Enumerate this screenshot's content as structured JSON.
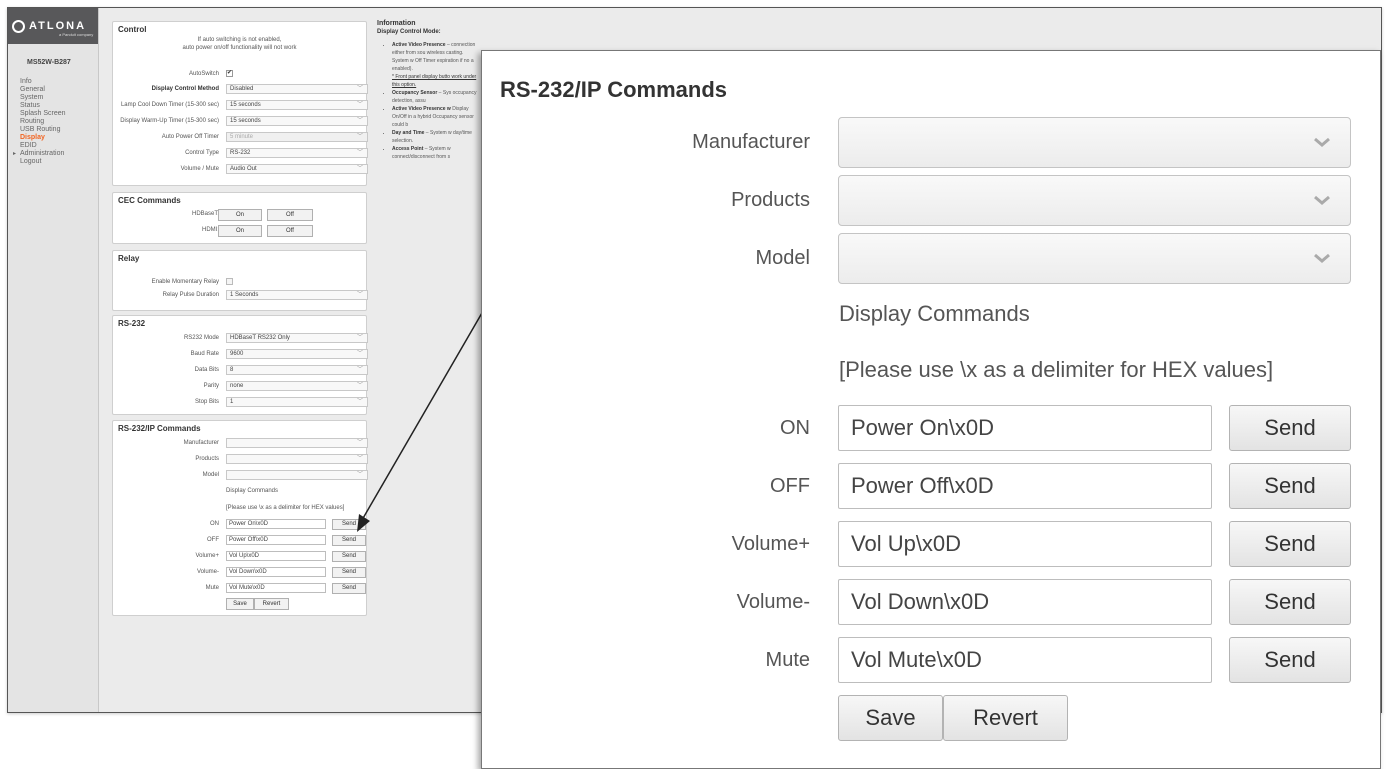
{
  "sidebar": {
    "logo_text": "ATLONA",
    "logo_sub": "a Panduit company",
    "device_name": "MS52W-B287",
    "nav": [
      "Info",
      "General",
      "System",
      "Status",
      "Splash Screen",
      "Routing",
      "USB Routing",
      "Display",
      "EDID",
      "Administration",
      "Logout"
    ],
    "active": "Display"
  },
  "control": {
    "title": "Control",
    "note_line1": "If auto switching is not enabled,",
    "note_line2": "auto power on/off functionality will not work",
    "autoswitch_label": "AutoSwitch",
    "autoswitch_checked": true,
    "method_label": "Display Control Method",
    "method_value": "Disabled",
    "cooldown_label": "Lamp Cool Down Timer (15-300 sec)",
    "cooldown_value": "15 seconds",
    "warmup_label": "Display Warm-Up Timer (15-300 sec)",
    "warmup_value": "15 seconds",
    "autooff_label": "Auto Power Off Timer",
    "autooff_value": "5 minute",
    "type_label": "Control Type",
    "type_value": "RS-232",
    "volume_label": "Volume / Mute",
    "volume_value": "Audio Out"
  },
  "cec": {
    "title": "CEC Commands",
    "hdbaset_label": "HDBaseT:",
    "hdmi_label": "HDMI:",
    "on_label": "On",
    "off_label": "Off"
  },
  "relay": {
    "title": "Relay",
    "momentary_label": "Enable Momentary Relay",
    "momentary_checked": false,
    "pulse_label": "Relay Pulse Duration",
    "pulse_value": "1 Seconds"
  },
  "rs232": {
    "title": "RS-232",
    "mode_label": "RS232 Mode",
    "mode_value": "HDBaseT RS232 Only",
    "baud_label": "Baud Rate",
    "baud_value": "9600",
    "databits_label": "Data Bits",
    "databits_value": "8",
    "parity_label": "Parity",
    "parity_value": "none",
    "stopbits_label": "Stop Bits",
    "stopbits_value": "1"
  },
  "rsip": {
    "title": "RS-232/IP Commands",
    "manufacturer_label": "Manufacturer",
    "products_label": "Products",
    "model_label": "Model",
    "display_commands": "Display Commands",
    "hex_note": "[Please use \\x as a delimiter for HEX values]",
    "commands": [
      {
        "label": "ON",
        "value": "Power On\\x0D"
      },
      {
        "label": "OFF",
        "value": "Power Off\\x0D"
      },
      {
        "label": "Volume+",
        "value": "Vol Up\\x0D"
      },
      {
        "label": "Volume-",
        "value": "Vol Down\\x0D"
      },
      {
        "label": "Mute",
        "value": "Vol Mute\\x0D"
      }
    ],
    "send_label": "Send",
    "save_label": "Save",
    "revert_label": "Revert"
  },
  "info": {
    "title": "Information",
    "subtitle": "Display Control Mode:",
    "items": [
      {
        "head": "Active Video Presence",
        "text": " – connection either from sou wireless casting. System w Off Timer expiration if no a enabled)."
      },
      {
        "head": "",
        "text": "* Front panel display butto work under this option."
      },
      {
        "head": "Occupancy Sensor",
        "text": " – Sys occupancy detection, assu"
      },
      {
        "head": "Active Video Presence w",
        "text": " Display On/Off in a hybrid Occupancy sensor could b"
      },
      {
        "head": "Day and Time",
        "text": " – System w day/time selection."
      },
      {
        "head": "Access Point",
        "text": " – System w connect/disconnect from s"
      }
    ]
  }
}
